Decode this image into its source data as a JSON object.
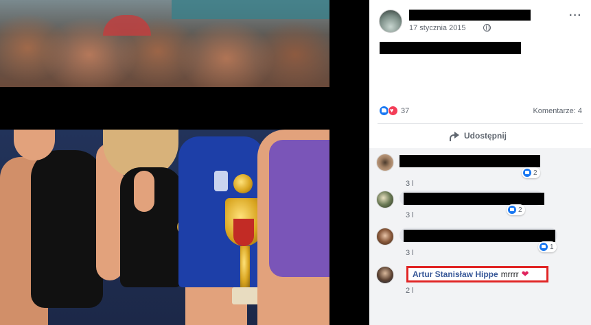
{
  "post": {
    "date": "17 stycznia 2015",
    "reactions_count": "37",
    "comments_label": "Komentarze: 4",
    "share_label": "Udostępnij",
    "more_icon": "more-horizontal-icon",
    "privacy_icon": "globe-icon"
  },
  "comments": [
    {
      "reactions": "2",
      "time": "3 l"
    },
    {
      "reactions": "2",
      "time": "3 l"
    },
    {
      "reactions": "1",
      "time": "3 l"
    },
    {
      "author": "Artur Stanisław Hippe",
      "text": "mrrrr",
      "emoji": "❤",
      "time": "2 l"
    }
  ],
  "colors": {
    "like_blue": "#1877f2",
    "love_red": "#f33e58",
    "author_link": "#385898",
    "highlight_border": "#e02424"
  }
}
